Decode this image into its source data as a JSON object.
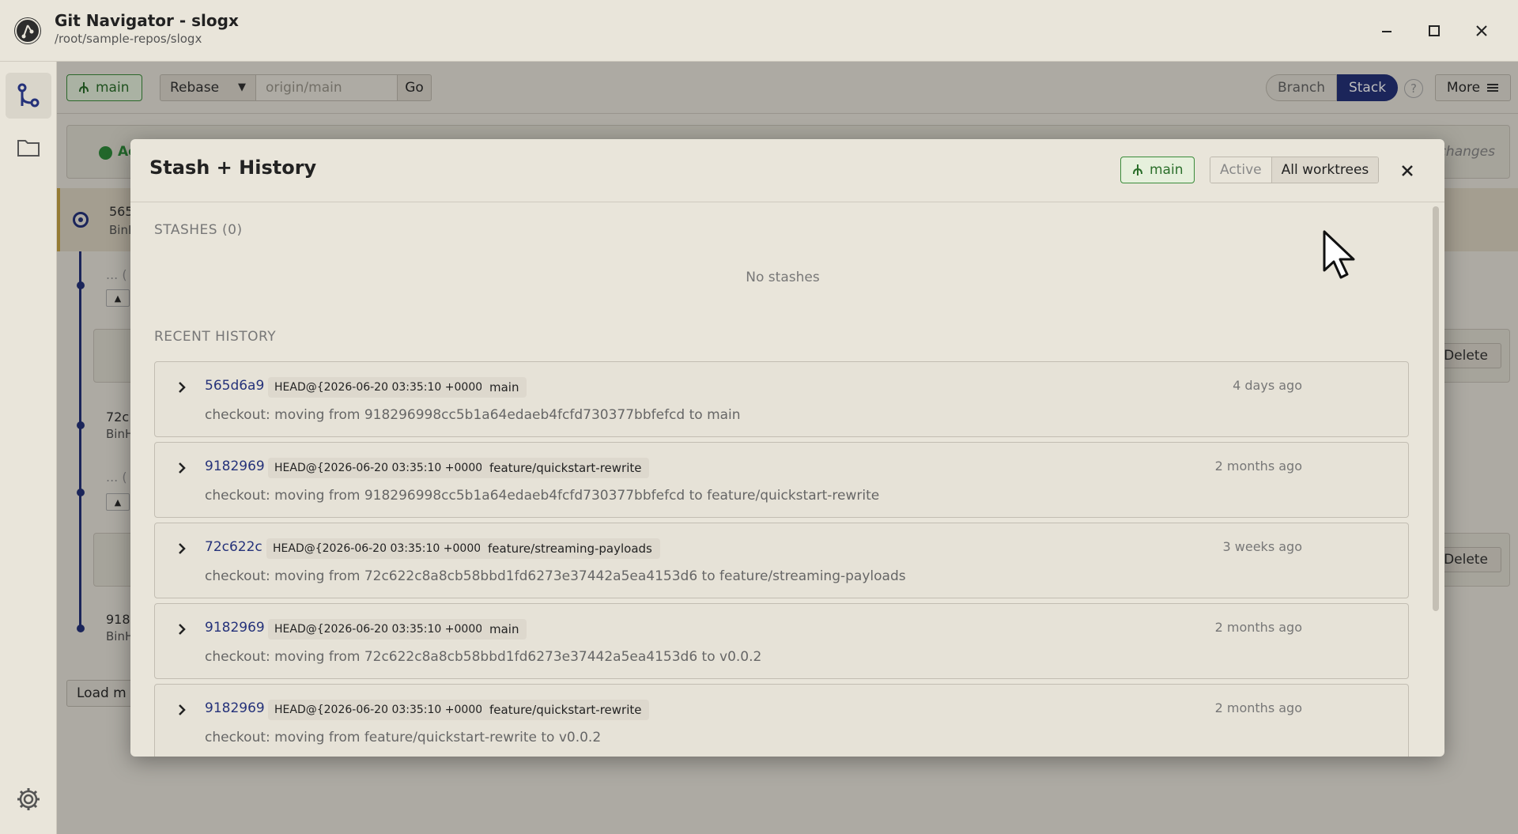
{
  "window": {
    "title": "Git Navigator - slogx",
    "path": "/root/sample-repos/slogx"
  },
  "toolbar": {
    "branch": "main",
    "mode": "Rebase",
    "target_placeholder": "origin/main",
    "go_label": "Go",
    "view_options": [
      "Branch",
      "Stack"
    ],
    "view_selected": "Stack",
    "help_label": "?",
    "more_label": "More"
  },
  "background": {
    "status_text": "Ac",
    "status_right": "changes",
    "commits": [
      {
        "hash": "565",
        "author": "BinH"
      },
      {
        "hash": "72c",
        "author": "BinH"
      },
      {
        "hash": "918",
        "author": "BinH"
      }
    ],
    "collapsed_label": "... (",
    "delete_label": "Delete",
    "load_more_label": "Load m"
  },
  "modal": {
    "title": "Stash + History",
    "branch": "main",
    "scope_options": [
      "Active",
      "All worktrees"
    ],
    "scope_selected": "All worktrees",
    "stashes_label": "STASHES (0)",
    "no_stashes": "No stashes",
    "history_label": "RECENT HISTORY",
    "entries": [
      {
        "hash": "565d6a9",
        "ref": "HEAD@{2026-06-20 03:35:10 +0000}",
        "branch": "main",
        "when": "4 days ago",
        "message": "checkout: moving from 918296998cc5b1a64edaeb4fcfd730377bbfefcd to main"
      },
      {
        "hash": "9182969",
        "ref": "HEAD@{2026-06-20 03:35:10 +0000}",
        "branch": "feature/quickstart-rewrite",
        "when": "2 months ago",
        "message": "checkout: moving from 918296998cc5b1a64edaeb4fcfd730377bbfefcd to feature/quickstart-rewrite"
      },
      {
        "hash": "72c622c",
        "ref": "HEAD@{2026-06-20 03:35:10 +0000}",
        "branch": "feature/streaming-payloads",
        "when": "3 weeks ago",
        "message": "checkout: moving from 72c622c8a8cb58bbd1fd6273e37442a5ea4153d6 to feature/streaming-payloads"
      },
      {
        "hash": "9182969",
        "ref": "HEAD@{2026-06-20 03:35:10 +0000}",
        "branch": "main",
        "when": "2 months ago",
        "message": "checkout: moving from 72c622c8a8cb58bbd1fd6273e37442a5ea4153d6 to v0.0.2"
      },
      {
        "hash": "9182969",
        "ref": "HEAD@{2026-06-20 03:35:10 +0000}",
        "branch": "feature/quickstart-rewrite",
        "when": "2 months ago",
        "message": "checkout: moving from feature/quickstart-rewrite to v0.0.2"
      }
    ]
  },
  "colors": {
    "accent": "#25327a",
    "branch_green": "#2a6e2a",
    "head_marker": "#c9a748"
  },
  "icons": [
    "app-logo-icon",
    "minimize-icon",
    "maximize-icon",
    "close-icon",
    "git-graph-icon",
    "folder-icon",
    "settings-gear-icon",
    "branch-icon",
    "chevron-right-icon",
    "hamburger-menu-icon",
    "mouse-cursor-icon"
  ]
}
